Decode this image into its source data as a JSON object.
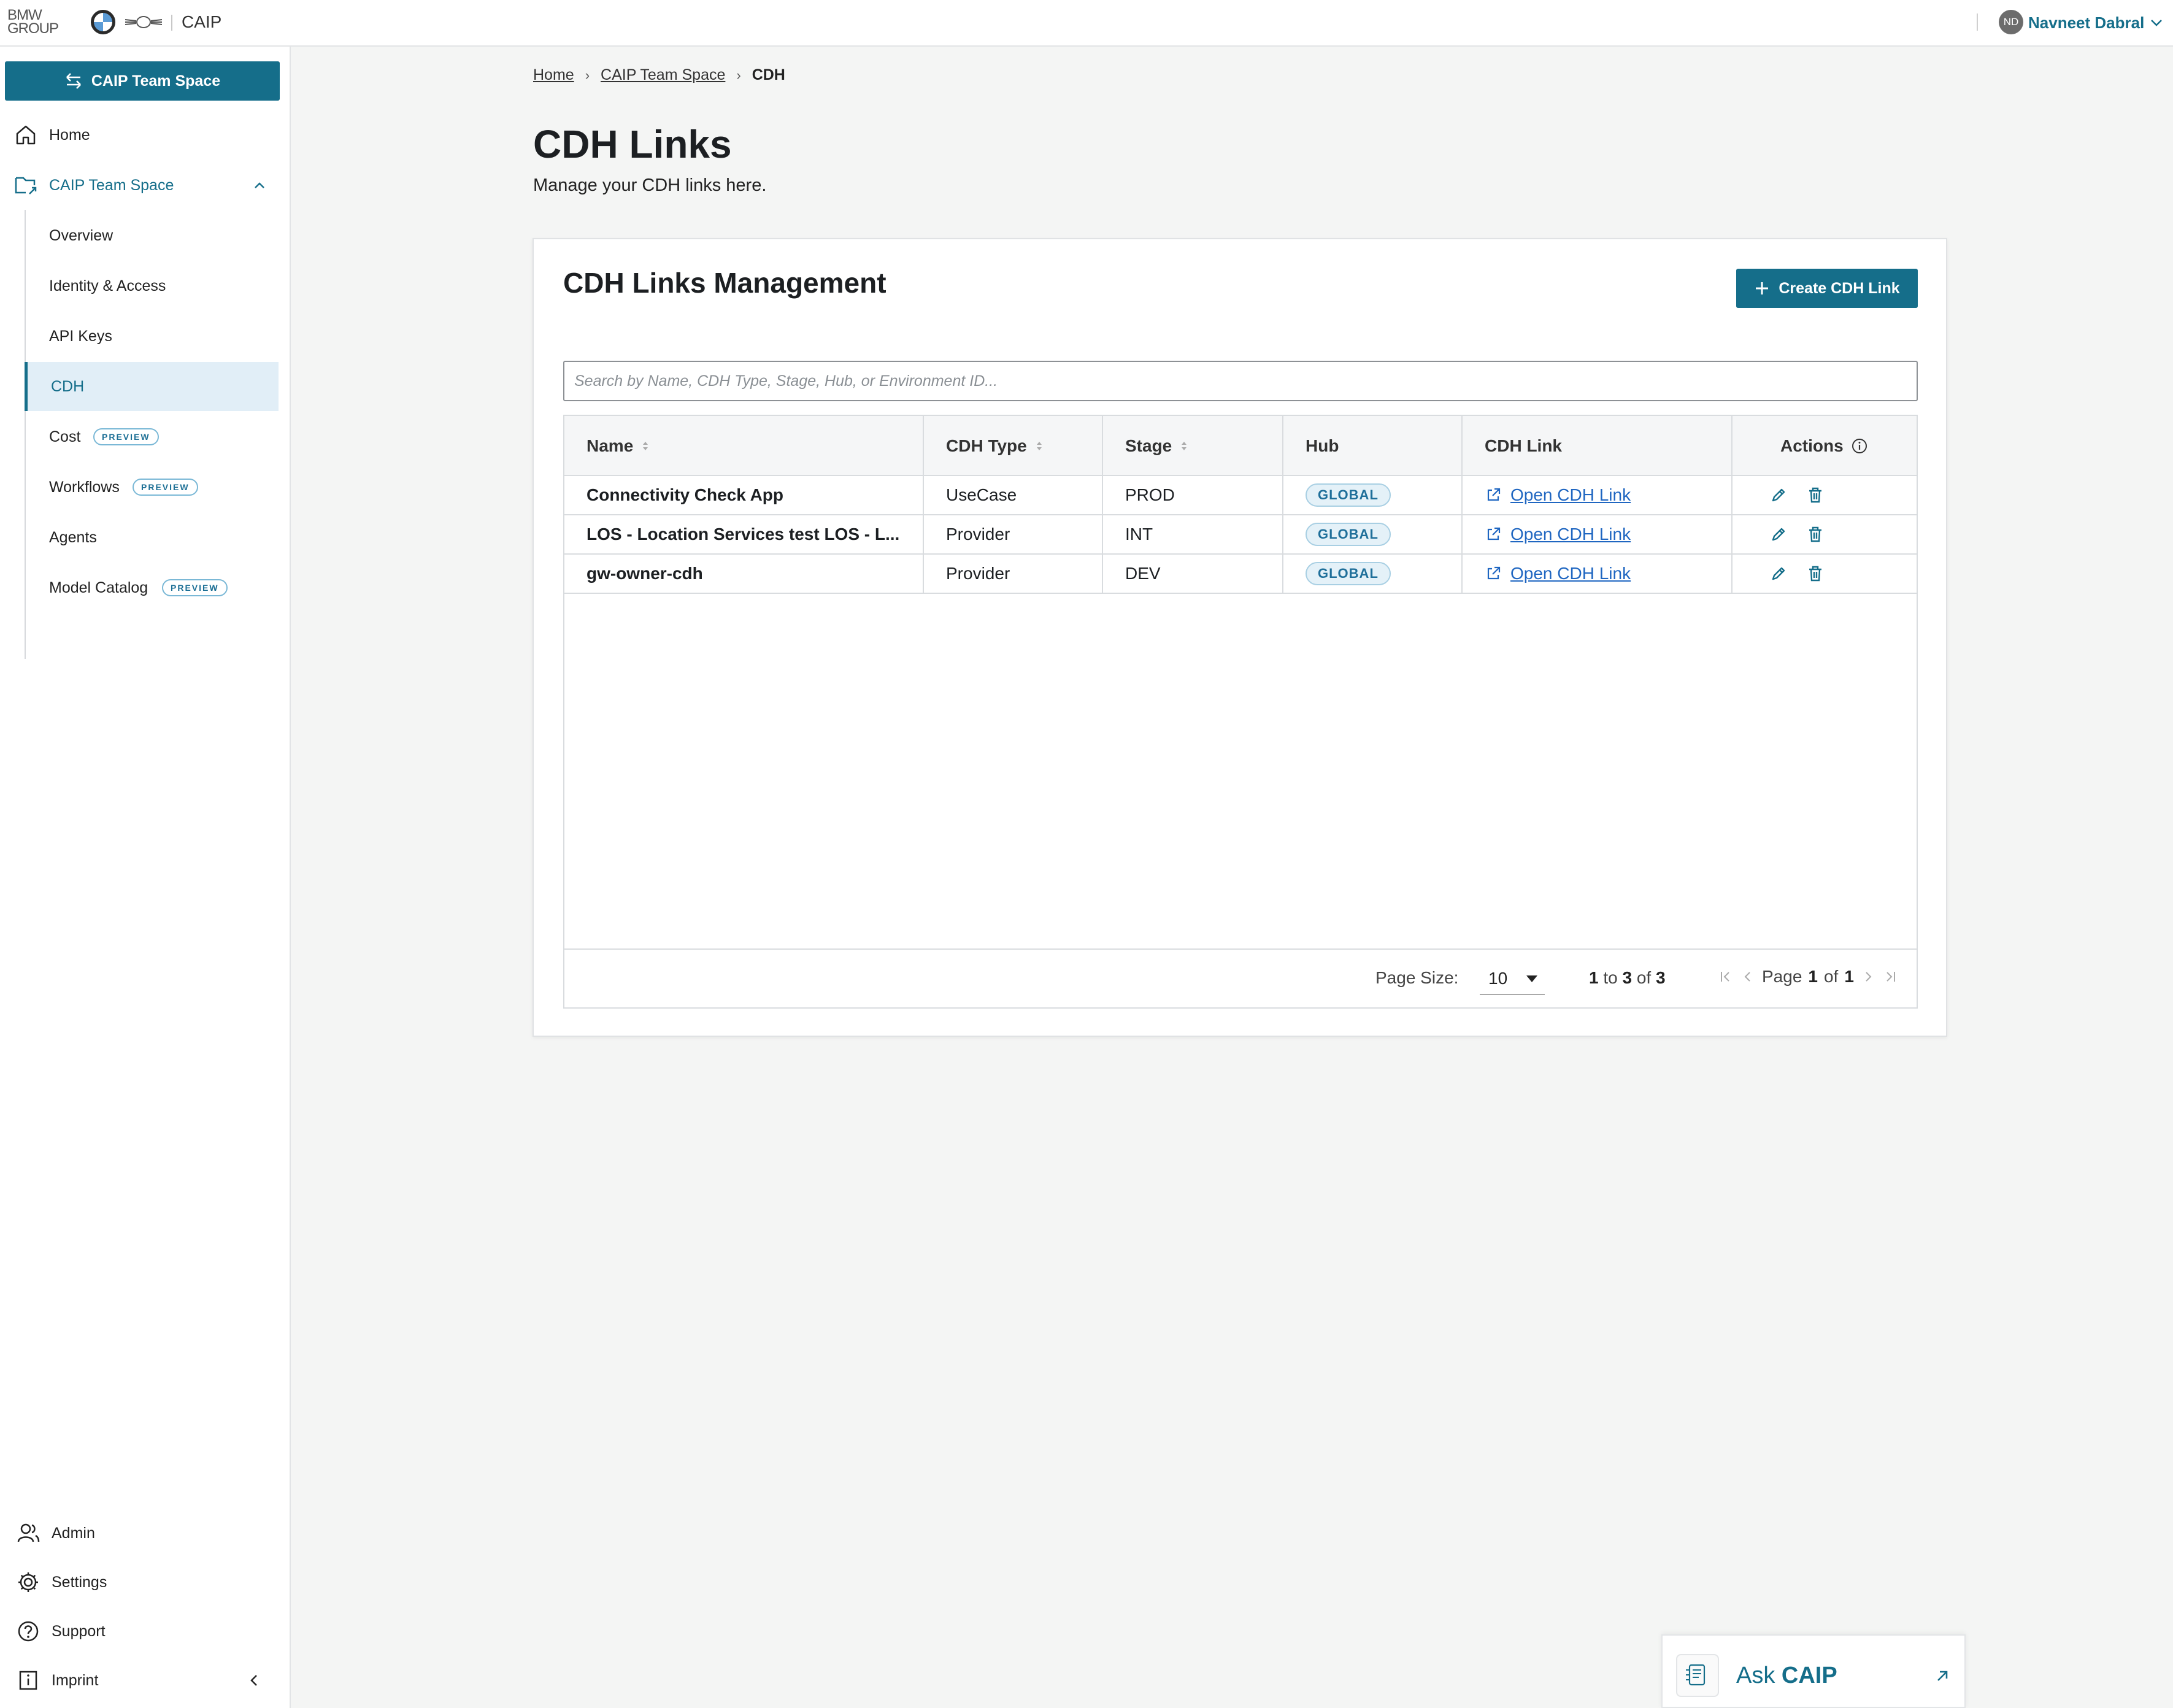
{
  "topbar": {
    "brand_line1": "BMW",
    "brand_line2": "GROUP",
    "app_name": "CAIP",
    "user_initials": "ND",
    "user_name": "Navneet Dabral"
  },
  "sidebar": {
    "space_button": "CAIP Team Space",
    "home": "Home",
    "space": "CAIP Team Space",
    "sub_items": [
      {
        "label": "Overview"
      },
      {
        "label": "Identity & Access"
      },
      {
        "label": "API Keys"
      },
      {
        "label": "CDH"
      },
      {
        "label": "Cost",
        "badge": "PREVIEW"
      },
      {
        "label": "Workflows",
        "badge": "PREVIEW"
      },
      {
        "label": "Agents"
      },
      {
        "label": "Model Catalog",
        "badge": "PREVIEW"
      }
    ],
    "bottom": {
      "admin": "Admin",
      "settings": "Settings",
      "support": "Support",
      "imprint": "Imprint"
    }
  },
  "breadcrumb": {
    "home": "Home",
    "space": "CAIP Team Space",
    "current": "CDH"
  },
  "page": {
    "title": "CDH Links",
    "subtitle": "Manage your CDH links here."
  },
  "card": {
    "title": "CDH Links Management",
    "create_button": "Create CDH Link",
    "search_placeholder": "Search by Name, CDH Type, Stage, Hub, or Environment ID..."
  },
  "table": {
    "columns": {
      "name": "Name",
      "type": "CDH Type",
      "stage": "Stage",
      "hub": "Hub",
      "link": "CDH Link",
      "actions": "Actions"
    },
    "rows": [
      {
        "name": "Connectivity Check App",
        "type": "UseCase",
        "stage": "PROD",
        "hub": "GLOBAL",
        "link": "Open CDH Link"
      },
      {
        "name": "LOS - Location Services test LOS - L...",
        "type": "Provider",
        "stage": "INT",
        "hub": "GLOBAL",
        "link": "Open CDH Link"
      },
      {
        "name": "gw-owner-cdh",
        "type": "Provider",
        "stage": "DEV",
        "hub": "GLOBAL",
        "link": "Open CDH Link"
      }
    ]
  },
  "pagination": {
    "page_size_label": "Page Size:",
    "page_size": "10",
    "range_from": "1",
    "range_to_word": "to",
    "range_to": "3",
    "range_of_word": "of",
    "range_total": "3",
    "page_word": "Page",
    "page_current": "1",
    "page_of_word": "of",
    "page_total": "1"
  },
  "ask": {
    "prefix": "Ask",
    "name": "CAIP"
  },
  "colors": {
    "accent": "#156e8a",
    "link": "#1f66c1",
    "active_bg": "#e1eef7"
  }
}
